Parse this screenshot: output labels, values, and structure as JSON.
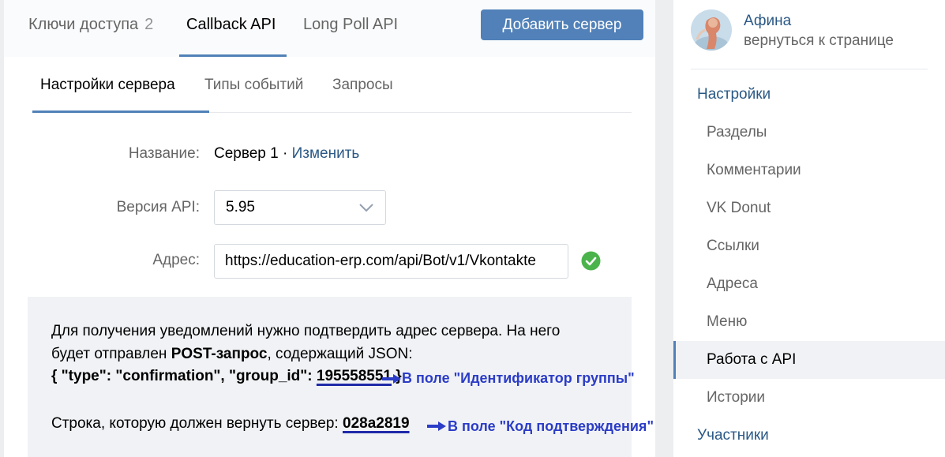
{
  "top_tabs": [
    {
      "label": "Ключи доступа",
      "count": "2"
    },
    {
      "label": "Callback API"
    },
    {
      "label": "Long Poll API"
    }
  ],
  "add_server_label": "Добавить сервер",
  "sub_tabs": [
    "Настройки сервера",
    "Типы событий",
    "Запросы"
  ],
  "form": {
    "name_label": "Название:",
    "name_value": "Сервер 1",
    "name_separator": " · ",
    "name_change": "Изменить",
    "api_label": "Версия API:",
    "api_value": "5.95",
    "address_label": "Адрес:",
    "address_value": "https://education-erp.com/api/Bot/v1/Vkontakte"
  },
  "info": {
    "line1": "Для получения уведомлений нужно подтвердить адрес сервера. На него",
    "line2_prefix": "будет отправлен ",
    "line2_bold": "POST-запрос",
    "line2_suffix": ", содержащий JSON:",
    "json_prefix": "{ \"type\": \"confirmation\", \"group_id\": ",
    "group_id": "195558551",
    "json_suffix": " }",
    "return_prefix": "Строка, которую должен вернуть сервер: ",
    "confirm_code": "028a2819"
  },
  "annotations": {
    "group_id_hint": "В поле \"Идентификатор группы\"",
    "code_hint": "В поле \"Код подтверждения\""
  },
  "sidebar": {
    "name": "Афина",
    "back": "вернуться к странице",
    "items": [
      {
        "label": "Настройки"
      },
      {
        "label": "Разделы"
      },
      {
        "label": "Комментарии"
      },
      {
        "label": "VK Donut"
      },
      {
        "label": "Ссылки"
      },
      {
        "label": "Адреса"
      },
      {
        "label": "Меню"
      },
      {
        "label": "Работа с API"
      },
      {
        "label": "Истории"
      },
      {
        "label": "Участники"
      }
    ]
  },
  "colors": {
    "accent": "#5181b8",
    "link": "#2a5885",
    "success": "#4bb34b",
    "annotation": "#2b3cc7"
  }
}
